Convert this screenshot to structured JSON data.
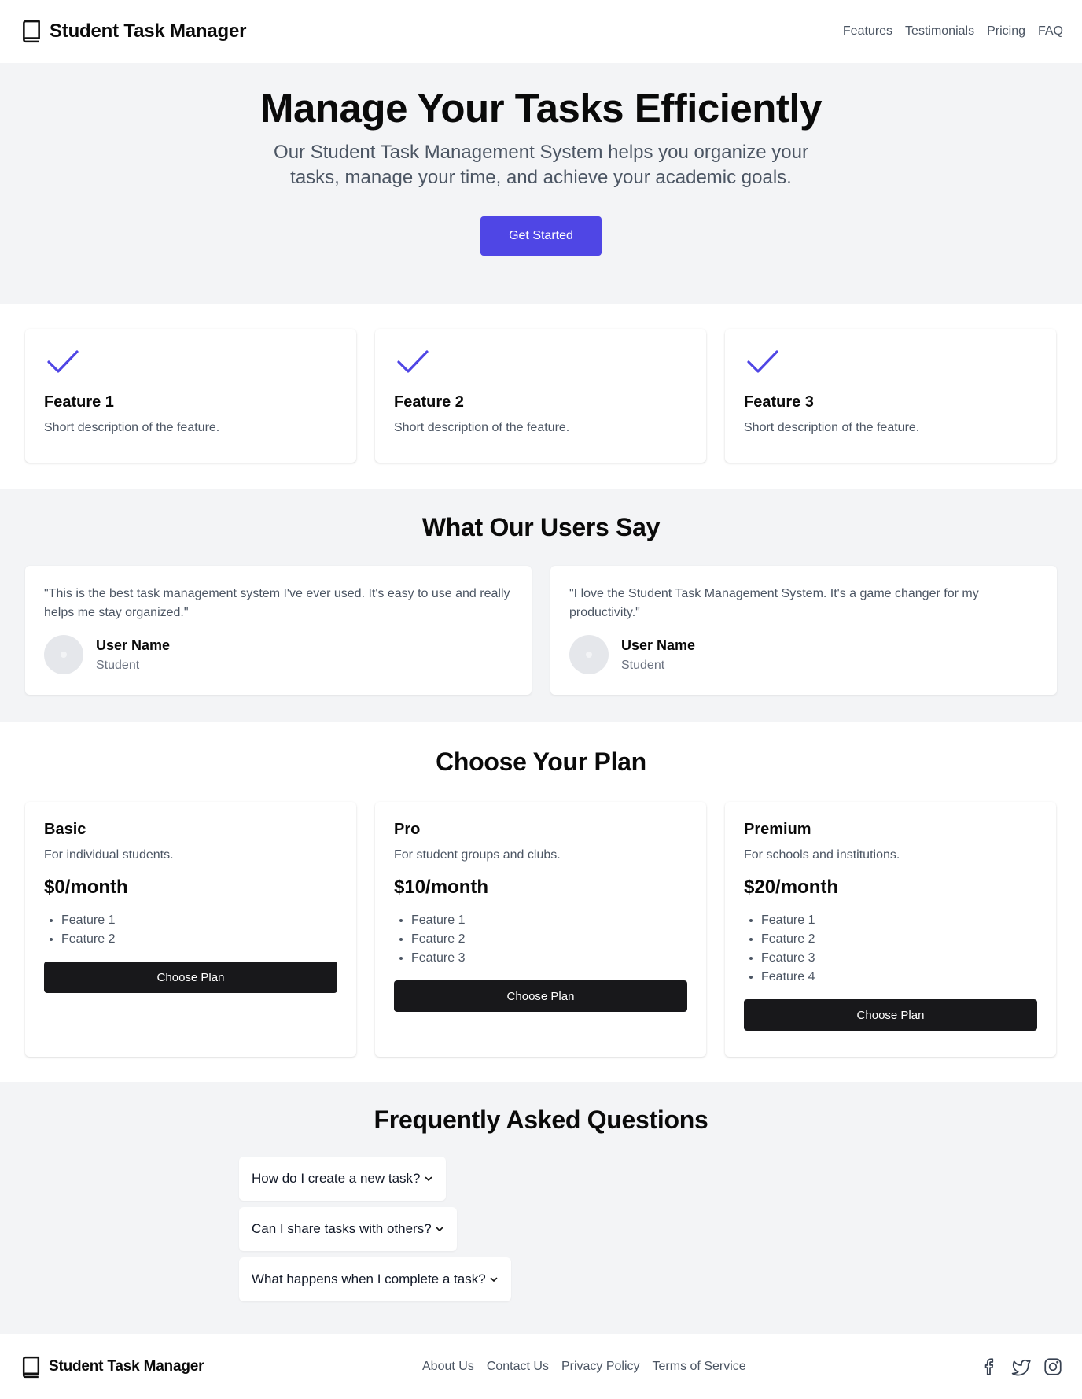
{
  "header": {
    "brand": "Student Task Manager",
    "nav": [
      "Features",
      "Testimonials",
      "Pricing",
      "FAQ"
    ]
  },
  "hero": {
    "title": "Manage Your Tasks Efficiently",
    "subtitle": "Our Student Task Management System helps you organize your tasks, manage your time, and achieve your academic goals.",
    "cta": "Get Started"
  },
  "colors": {
    "accent": "#4f46e5",
    "dark_button": "#18181b",
    "section_bg": "#f3f4f6",
    "muted_text": "#4b5563"
  },
  "features": [
    {
      "icon": "check-icon",
      "title": "Feature 1",
      "description": "Short description of the feature."
    },
    {
      "icon": "check-icon",
      "title": "Feature 2",
      "description": "Short description of the feature."
    },
    {
      "icon": "check-icon",
      "title": "Feature 3",
      "description": "Short description of the feature."
    }
  ],
  "testimonials": {
    "title": "What Our Users Say",
    "items": [
      {
        "quote": "\"This is the best task management system I've ever used. It's easy to use and really helps me stay organized.\"",
        "name": "User Name",
        "role": "Student"
      },
      {
        "quote": "\"I love the Student Task Management System. It's a game changer for my productivity.\"",
        "name": "User Name",
        "role": "Student"
      }
    ]
  },
  "pricing": {
    "title": "Choose Your Plan",
    "plans": [
      {
        "name": "Basic",
        "description": "For individual students.",
        "price": "$0/month",
        "features": [
          "Feature 1",
          "Feature 2"
        ],
        "button": "Choose Plan"
      },
      {
        "name": "Pro",
        "description": "For student groups and clubs.",
        "price": "$10/month",
        "features": [
          "Feature 1",
          "Feature 2",
          "Feature 3"
        ],
        "button": "Choose Plan"
      },
      {
        "name": "Premium",
        "description": "For schools and institutions.",
        "price": "$20/month",
        "features": [
          "Feature 1",
          "Feature 2",
          "Feature 3",
          "Feature 4"
        ],
        "button": "Choose Plan"
      }
    ]
  },
  "faq": {
    "title": "Frequently Asked Questions",
    "items": [
      "How do I create a new task?",
      "Can I share tasks with others?",
      "What happens when I complete a task?"
    ]
  },
  "footer": {
    "brand": "Student Task Manager",
    "links": [
      "About Us",
      "Contact Us",
      "Privacy Policy",
      "Terms of Service"
    ],
    "social_icons": [
      "facebook-icon",
      "twitter-icon",
      "instagram-icon"
    ]
  }
}
